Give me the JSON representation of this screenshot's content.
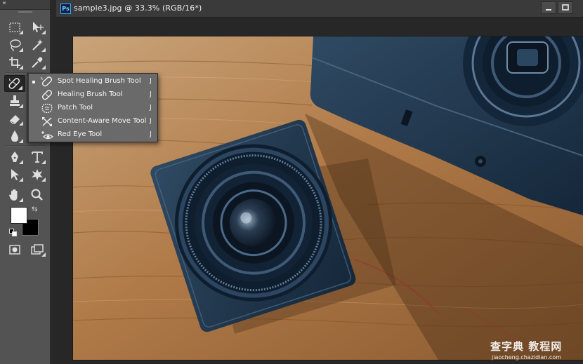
{
  "document": {
    "app_badge": "Ps",
    "title": "sample3.jpg @ 33.3% (RGB/16*)"
  },
  "toolbar": {
    "collapse_glyph": "«",
    "tools": [
      {
        "name": "rectangular-marquee-icon"
      },
      {
        "name": "move-tool-icon"
      },
      {
        "name": "lasso-icon"
      },
      {
        "name": "magic-wand-icon"
      },
      {
        "name": "crop-icon"
      },
      {
        "name": "eyedropper-icon"
      },
      {
        "name": "spot-healing-brush-icon"
      },
      {
        "name": "clone-stamp-icon"
      },
      {
        "name": "eraser-icon"
      },
      {
        "name": "blur-drop-icon"
      },
      {
        "name": "pen-icon"
      },
      {
        "name": "type-icon"
      },
      {
        "name": "path-selection-icon"
      },
      {
        "name": "custom-shape-icon"
      },
      {
        "name": "hand-icon"
      },
      {
        "name": "zoom-icon"
      },
      {
        "name": "quick-mask-icon"
      },
      {
        "name": "screen-mode-icon"
      }
    ],
    "foreground_color": "#ffffff",
    "background_color": "#000000"
  },
  "flyout": {
    "items": [
      {
        "label": "Spot Healing Brush Tool",
        "shortcut": "J",
        "selected": true,
        "icon": "spot-healing-brush-icon"
      },
      {
        "label": "Healing Brush Tool",
        "shortcut": "J",
        "selected": false,
        "icon": "healing-brush-icon"
      },
      {
        "label": "Patch Tool",
        "shortcut": "J",
        "selected": false,
        "icon": "patch-icon"
      },
      {
        "label": "Content-Aware Move Tool",
        "shortcut": "J",
        "selected": false,
        "icon": "content-aware-move-icon"
      },
      {
        "label": "Red Eye Tool",
        "shortcut": "J",
        "selected": false,
        "icon": "red-eye-icon"
      }
    ]
  },
  "watermark": {
    "logo_text": "查字典 教程网",
    "url": "jiaocheng.chazidian.com"
  },
  "colors": {
    "panel": "#535353",
    "flyout": "#6a6a6a",
    "accent_ps": "#33b0ff"
  }
}
